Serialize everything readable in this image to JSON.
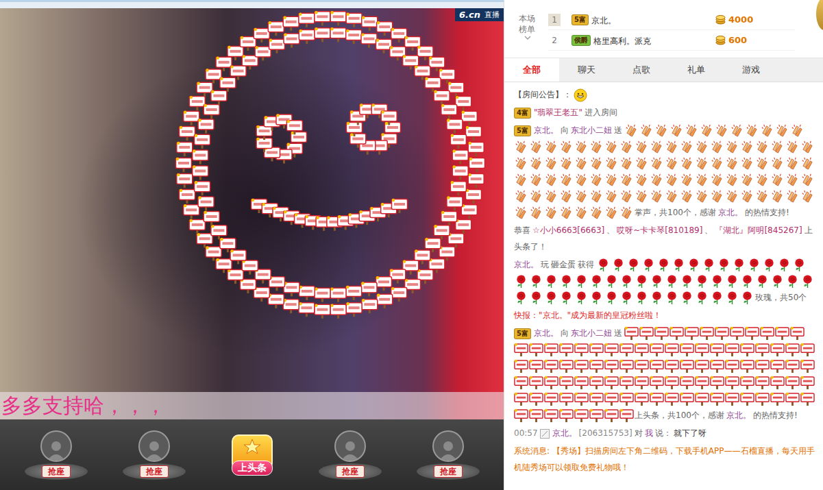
{
  "video": {
    "logo": "6.cn",
    "live_badge": "直播",
    "caption": "多多支持哈，，，"
  },
  "seats": [
    {
      "kind": "seat",
      "label": "抢座"
    },
    {
      "kind": "seat",
      "label": "抢座"
    },
    {
      "kind": "headline",
      "label": "上头条"
    },
    {
      "kind": "seat",
      "label": "抢座"
    },
    {
      "kind": "seat",
      "label": "抢座"
    }
  ],
  "ranking": {
    "title": "本场榜单",
    "rows": [
      {
        "rank": "1",
        "boxed": true,
        "badge": {
          "text": "5富",
          "color": "#e9b52a"
        },
        "name": "京北。",
        "amount": "4000"
      },
      {
        "rank": "2",
        "boxed": false,
        "badge": {
          "text": "侯爵",
          "color": "#79c23e"
        },
        "name": "格里高利。派克",
        "amount": "600"
      }
    ]
  },
  "tabs": [
    {
      "label": "全部",
      "selected": true
    },
    {
      "label": "聊天",
      "selected": false
    },
    {
      "label": "点歌",
      "selected": false
    },
    {
      "label": "礼单",
      "selected": false
    },
    {
      "label": "游戏",
      "selected": false
    }
  ],
  "messages": [
    {
      "kind": "notice",
      "label": "【房间公告】："
    },
    {
      "kind": "enter",
      "badge": {
        "text": "4富",
        "color": "#e9b52a"
      },
      "user": "\"翡翠王老五\"",
      "text": "进入房间"
    },
    {
      "kind": "gift",
      "badge": {
        "text": "5富",
        "color": "#e9b52a"
      },
      "user": "京北。",
      "to_word": "向",
      "target": "东北小二妞",
      "send_word": "送",
      "gift": "clap",
      "icon_count": 100,
      "summary": "掌声，共100个，感谢",
      "thanks_user": "京北。",
      "thanks": "的热情支持!"
    },
    {
      "kind": "headline",
      "prefix": "恭喜",
      "names": [
        "☆小小6663[6663]",
        "哎呀~卡卡琴[810189]",
        "『湖北』阿明[845267]"
      ],
      "separator": "、",
      "suffix": "上头条了！"
    },
    {
      "kind": "egg",
      "user": "京北。",
      "verb": "玩",
      "game": "砸金蛋",
      "got": "获得",
      "gift": "rose",
      "icon_count": 50,
      "summary": "玫瑰，共50个"
    },
    {
      "kind": "news",
      "text": "快报：\"京北。\"成为最新的皇冠粉丝啦！"
    },
    {
      "kind": "gift",
      "badge": {
        "text": "5富",
        "color": "#e9b52a"
      },
      "user": "京北。",
      "to_word": "向",
      "target": "东北小二妞",
      "send_word": "送",
      "gift": "headline",
      "icon_count": 100,
      "summary": "上头条，共100个，感谢",
      "thanks_user": "京北。",
      "thanks": "的热情支持!"
    },
    {
      "kind": "chat",
      "time": "00:57",
      "user": "京北。",
      "user_id": "[206315753]",
      "to_word": "对",
      "target": "我",
      "say_word": "说：",
      "text": "就下了呀"
    },
    {
      "kind": "system",
      "text": "系统消息: 【秀场】扫描房间左下角二维码，下载手机APP——石榴直播，每天用手机陆秀场可以领取免费礼物哦！"
    }
  ]
}
